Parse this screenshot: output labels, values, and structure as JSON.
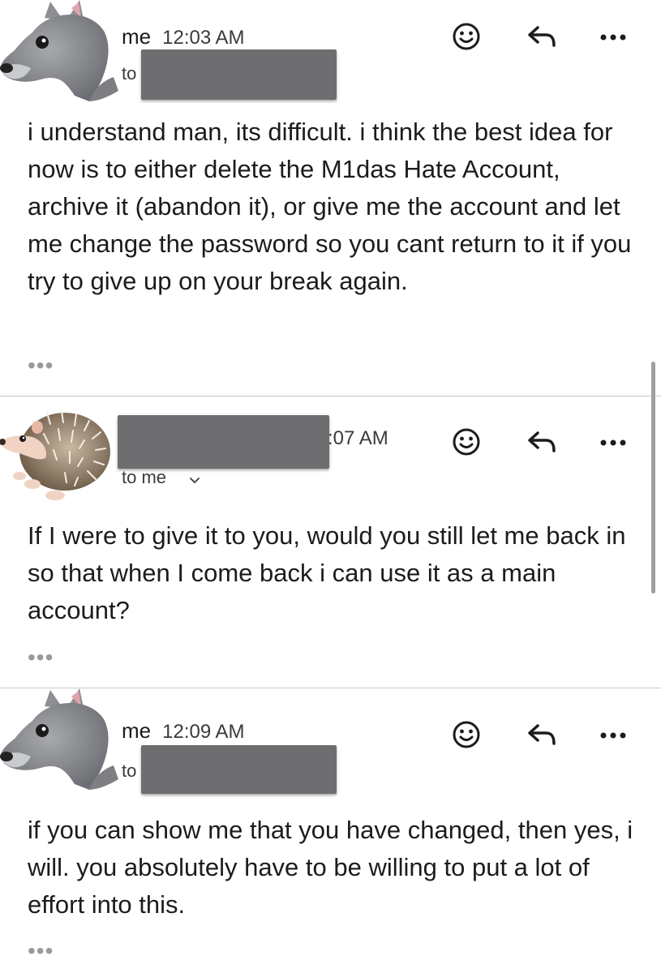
{
  "messages": [
    {
      "sender": "me",
      "time": "12:03 AM",
      "to_label": "to",
      "avatar": "wolf-memoji",
      "body": "i understand man, its difficult. i think the best idea for now is to either delete the M1das Hate Account, archive it (abandon it), or give me the account and let me change the password so you cant return to it if you try to give up on your break again.",
      "more": "•••"
    },
    {
      "sender": "",
      "time": ":07 AM",
      "to_label": "to me",
      "avatar": "hedgehog-memoji",
      "body": "If I were to give it to you, would you still let me back in so that when I come back i can use it as a main account?",
      "more": "•••"
    },
    {
      "sender": "me",
      "time": "12:09 AM",
      "to_label": "to",
      "avatar": "wolf-memoji",
      "body": "if you can show me that you have changed, then yes, i will. you absolutely have to be willing to put a lot of effort into this.",
      "more": "•••"
    }
  ],
  "icons": {
    "reaction": "emoji-reaction-icon",
    "reply": "reply-icon",
    "more": "more-options-icon"
  },
  "colors": {
    "redaction": "#6e6e70",
    "divider": "#c8c8cc",
    "text": "#1c1c1e"
  }
}
